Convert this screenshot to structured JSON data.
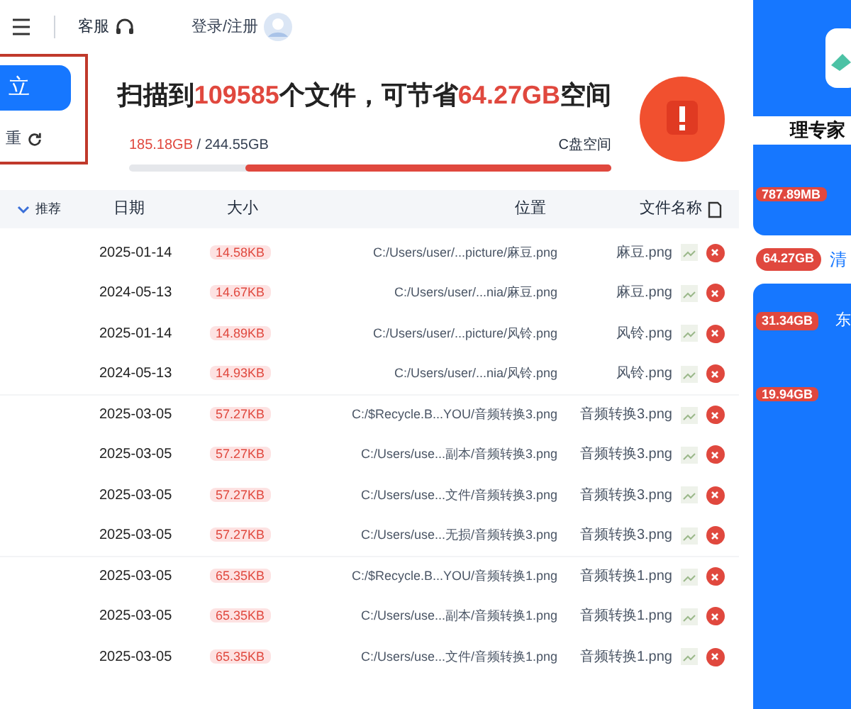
{
  "header": {
    "support": "客服",
    "login": "登录/注册"
  },
  "scan_panel": {
    "action_button": "立",
    "rescan": "重",
    "headline": [
      {
        "text": "扫描到",
        "highlight": false
      },
      {
        "text": "109585",
        "highlight": true
      },
      {
        "text": "个文件，可节省",
        "highlight": false
      },
      {
        "text": "64.27GB",
        "highlight": true
      },
      {
        "text": "空间",
        "highlight": false
      }
    ],
    "disk_label": "C盘空间",
    "used": "185.18GB",
    "separator": "/",
    "total": "244.55GB",
    "level": 0.76
  },
  "table": {
    "columns": [
      "日期",
      "大小",
      "位置",
      "文件名称"
    ],
    "sort": "推荐",
    "rows": [
      {
        "name": "麻豆.png",
        "location": "C:/Users/user/...picture/麻豆.png",
        "size": "14.58KB",
        "date": "2025-01-14"
      },
      {
        "name": "麻豆.png",
        "location": "C:/Users/user/...nia/麻豆.png",
        "size": "14.67KB",
        "date": "2024-05-13"
      },
      {
        "name": "风铃.png",
        "location": "C:/Users/user/...picture/风铃.png",
        "size": "14.89KB",
        "date": "2025-01-14"
      },
      {
        "name": "风铃.png",
        "location": "C:/Users/user/...nia/风铃.png",
        "size": "14.93KB",
        "date": "2024-05-13"
      },
      {
        "name": "音频转换3.png",
        "location": "C:/$Recycle.B...YOU/音频转换3.png",
        "size": "57.27KB",
        "date": "2025-03-05"
      },
      {
        "name": "音频转换3.png",
        "location": "C:/Users/use...副本/音频转换3.png",
        "size": "57.27KB",
        "date": "2025-03-05"
      },
      {
        "name": "音频转换3.png",
        "location": "C:/Users/use...文件/音频转换3.png",
        "size": "57.27KB",
        "date": "2025-03-05"
      },
      {
        "name": "音频转换3.png",
        "location": "C:/Users/use...无损/音频转换3.png",
        "size": "57.27KB",
        "date": "2025-03-05"
      },
      {
        "name": "音频转换1.png",
        "location": "C:/$Recycle.B...YOU/音频转换1.png",
        "size": "65.35KB",
        "date": "2025-03-05"
      },
      {
        "name": "音频转换1.png",
        "location": "C:/Users/use...副本/音频转换1.png",
        "size": "65.35KB",
        "date": "2025-03-05"
      },
      {
        "name": "音频转换1.png",
        "location": "C:/Users/use...文件/音频转换1.png",
        "size": "65.35KB",
        "date": "2025-03-05"
      }
    ]
  },
  "sidebar": {
    "title": "理专家",
    "size": "787.89MB",
    "clean_link": "清",
    "clean_size": "64.27GB",
    "card_label": "东",
    "card_sizes": [
      "31.34GB",
      "19.94GB"
    ]
  }
}
